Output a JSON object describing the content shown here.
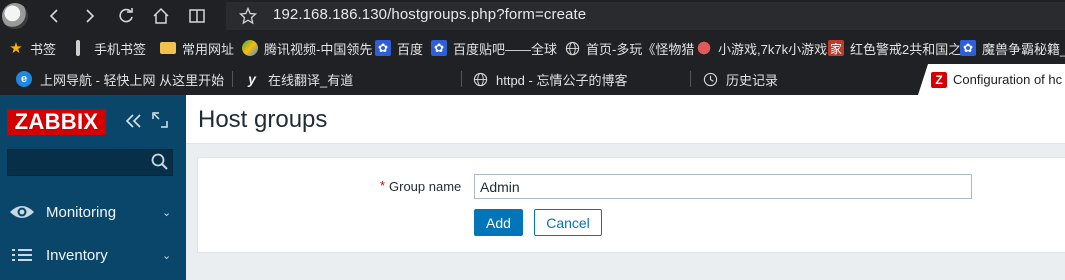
{
  "browser": {
    "url": "192.168.186.130/hostgroups.php?form=create",
    "nav_icons": [
      "back-icon",
      "forward-icon",
      "reload-icon",
      "home-icon",
      "reading-view-icon",
      "favorite-star-icon"
    ]
  },
  "bookmarks": [
    {
      "label": "书签",
      "icon": "star-icon"
    },
    {
      "label": "手机书签",
      "icon": "folder-icon"
    },
    {
      "label": "常用网址",
      "icon": "folder-icon"
    },
    {
      "label": "腾讯视频-中国领先",
      "icon": "tencent-video-icon"
    },
    {
      "label": "百度",
      "icon": "baidu-paw-icon"
    },
    {
      "label": "百度贴吧——全球",
      "icon": "baidu-paw-icon"
    },
    {
      "label": "首页-多玩《怪物猎",
      "icon": "globe-icon"
    },
    {
      "label": "小游戏,7k7k小游戏",
      "icon": "balloon-icon"
    },
    {
      "label": "红色警戒2共和国之",
      "icon": "jia-icon"
    },
    {
      "label": "魔兽争霸秘籍_百",
      "icon": "baidu-paw-icon"
    }
  ],
  "tabs": [
    {
      "label": "上网导航 - 轻快上网 从这里开始",
      "icon": "ie-e-icon"
    },
    {
      "label": "在线翻译_有道",
      "icon": "youdao-y-icon"
    },
    {
      "label": "httpd - 忘情公子的博客",
      "icon": "globe-icon"
    },
    {
      "label": "历史记录",
      "icon": "history-clock-icon"
    },
    {
      "label": "Configuration of hc",
      "icon": "zabbix-z-icon",
      "active": true
    }
  ],
  "sidebar": {
    "logo": "ZABBIX",
    "search": {
      "value": "",
      "placeholder": ""
    },
    "menu": [
      {
        "label": "Monitoring",
        "icon": "eye-icon"
      },
      {
        "label": "Inventory",
        "icon": "list-icon"
      }
    ]
  },
  "page": {
    "title": "Host groups",
    "form": {
      "required_mark": "*",
      "group_name_label": "Group name",
      "group_name_value": "Admin",
      "add_label": "Add",
      "cancel_label": "Cancel"
    }
  },
  "colors": {
    "zabbix_red": "#d40000",
    "sidebar_blue": "#0a466a",
    "button_blue": "#0275b8",
    "browser_dark": "#202124"
  }
}
